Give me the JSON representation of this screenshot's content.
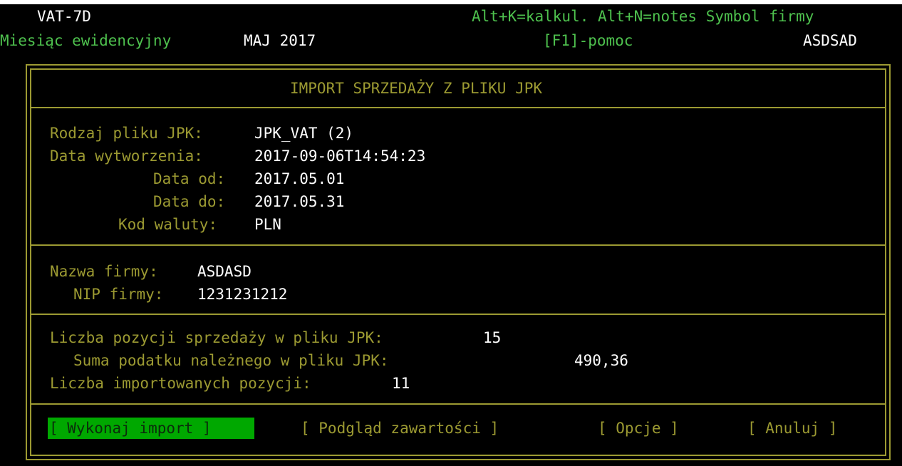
{
  "header": {
    "app_code": "VAT-7D",
    "shortcuts": "Alt+K=kalkul. Alt+N=notes Symbol firmy",
    "month_label": "Miesiąc ewidencyjny",
    "month_value": "MAJ 2017",
    "help": "[F1]-pomoc",
    "company_symbol": "ASDSAD"
  },
  "dialog": {
    "title": "IMPORT SPRZEDAŻY Z PLIKU JPK",
    "file_info": {
      "file_type_label": "Rodzaj pliku JPK:",
      "file_type_value": "JPK_VAT (2)",
      "created_label": "Data wytworzenia:",
      "created_value": "2017-09-06T14:54:23",
      "date_from_label": "Data od:",
      "date_from_value": "2017.05.01",
      "date_to_label": "Data do:",
      "date_to_value": "2017.05.31",
      "currency_label": "Kod waluty:",
      "currency_value": "PLN"
    },
    "company": {
      "name_label": "Nazwa firmy:",
      "name_value": "ASDASD",
      "nip_label": "NIP firmy:",
      "nip_value": "1231231212"
    },
    "summary": {
      "count_label": "Liczba pozycji sprzedaży w pliku JPK:",
      "count_value": "15",
      "tax_sum_label": "Suma podatku należnego w pliku JPK:",
      "tax_sum_value": "490,36",
      "imported_label": "Liczba importowanych pozycji:",
      "imported_value": "11"
    },
    "buttons": {
      "import": "[ Wykonaj import ]",
      "preview": "[ Podgląd zawartości ]",
      "options": "[ Opcje ]",
      "cancel": "[ Anuluj ]"
    }
  },
  "colors": {
    "background": "#000000",
    "label": "#9c9a32",
    "value": "#ffffff",
    "header_green": "#4ec14e",
    "selected_button": "#00a800"
  }
}
